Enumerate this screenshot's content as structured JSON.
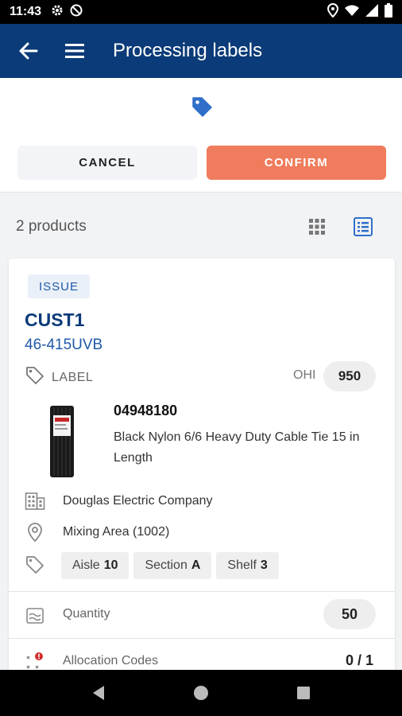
{
  "status_bar": {
    "time": "11:43",
    "icons": [
      "settings-icon",
      "blocked-icon",
      "location-icon",
      "wifi-icon",
      "signal-icon",
      "battery-icon"
    ]
  },
  "app_bar": {
    "title": "Processing labels",
    "icons": [
      "back-arrow-icon",
      "hamburger-menu-icon"
    ]
  },
  "actions": {
    "cancel_label": "CANCEL",
    "confirm_label": "CONFIRM"
  },
  "list": {
    "count_label": "2 products",
    "views": [
      "grid-view-icon",
      "list-view-icon"
    ]
  },
  "card": {
    "badge": "ISSUE",
    "customer": "CUST1",
    "part_number": "46-415UVB",
    "label_text": "LABEL",
    "ohi_label": "OHI",
    "ohi_value": "950",
    "sku": "04948180",
    "description": "Black Nylon 6/6 Heavy Duty Cable Tie 15 in Length",
    "company": "Douglas Electric Company",
    "area": "Mixing Area (1002)",
    "location": {
      "aisle_label": "Aisle",
      "aisle_value": "10",
      "section_label": "Section",
      "section_value": "A",
      "shelf_label": "Shelf",
      "shelf_value": "3"
    },
    "quantity_label": "Quantity",
    "quantity_value": "50",
    "allocation_label": "Allocation Codes",
    "allocation_value": "0 / 1"
  },
  "colors": {
    "app_bar": "#0b3b78",
    "confirm": "#ef7c5c",
    "accent_blue": "#1f5aa8",
    "alert_red": "#d32f2f"
  }
}
